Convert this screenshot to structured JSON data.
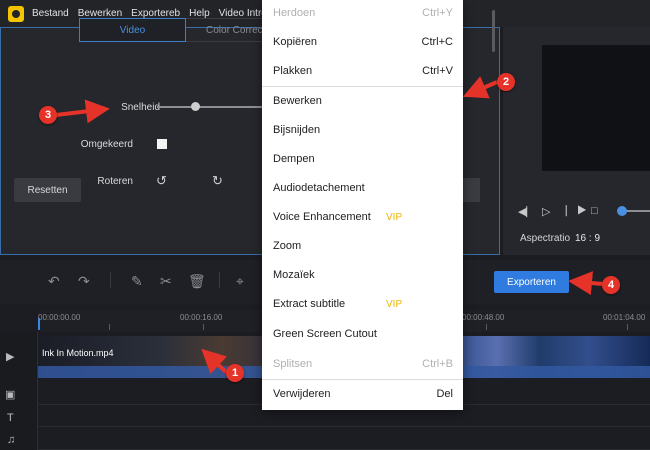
{
  "menubar": {
    "items": [
      "Bestand",
      "Bewerken",
      "Exportereb",
      "Help",
      "Video Intro &"
    ]
  },
  "props": {
    "tabs": [
      "Video",
      "Color Correc"
    ],
    "speed_label": "Snelheid",
    "reverse_label": "Omgekeerd",
    "rotate_label": "Roteren",
    "reset_label": "Resetten"
  },
  "preview": {
    "aspect_label": "Aspectratio",
    "aspect_value": "16 : 9"
  },
  "toolbar": {
    "export_label": "Exporteren"
  },
  "timeline": {
    "ticks": [
      "00:00:00.00",
      "00:00:16.00",
      "00:00:48.00",
      "00:01:04.00"
    ],
    "clip_name": "Ink In Motion.mp4"
  },
  "context_menu": {
    "items": [
      {
        "label": "Herdoen",
        "shortcut": "Ctrl+Y",
        "disabled": true
      },
      {
        "label": "Kopiëren",
        "shortcut": "Ctrl+C",
        "disabled": false
      },
      {
        "label": "Plakken",
        "shortcut": "Ctrl+V",
        "disabled": false
      },
      {
        "label": "Bewerken",
        "shortcut": "",
        "disabled": false
      },
      {
        "label": "Bijsnijden",
        "shortcut": "",
        "disabled": false
      },
      {
        "label": "Dempen",
        "shortcut": "",
        "disabled": false
      },
      {
        "label": "Audiodetachement",
        "shortcut": "",
        "disabled": false
      },
      {
        "label": "Voice Enhancement",
        "shortcut": "",
        "disabled": false,
        "badge": "VIP"
      },
      {
        "label": "Zoom",
        "shortcut": "",
        "disabled": false
      },
      {
        "label": "Mozaïek",
        "shortcut": "",
        "disabled": false
      },
      {
        "label": "Extract subtitle",
        "shortcut": "",
        "disabled": false,
        "badge": "VIP"
      },
      {
        "label": "Green Screen Cutout",
        "shortcut": "",
        "disabled": false
      },
      {
        "label": "Splitsen",
        "shortcut": "Ctrl+B",
        "disabled": true
      },
      {
        "label": "Verwijderen",
        "shortcut": "Del",
        "disabled": false
      }
    ]
  },
  "callouts": [
    "1",
    "2",
    "3",
    "4"
  ],
  "colors": {
    "accent": "#2f7be0",
    "callout": "#e5332a",
    "vip": "#f0b400"
  }
}
